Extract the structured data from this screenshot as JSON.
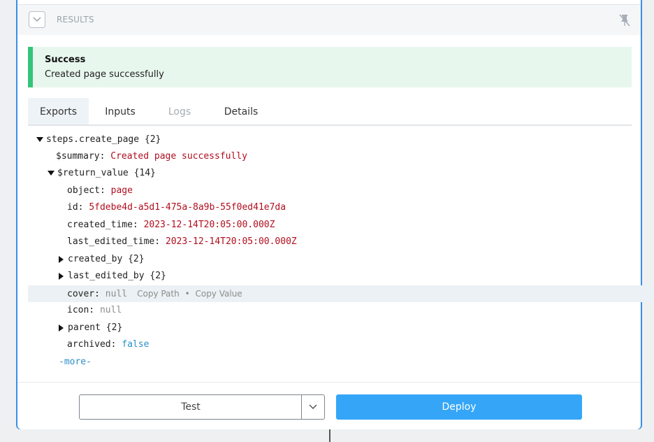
{
  "results": {
    "title": "RESULTS"
  },
  "alert": {
    "title": "Success",
    "message": "Created page successfully"
  },
  "tabs": [
    {
      "label": "Exports",
      "state": "active"
    },
    {
      "label": "Inputs",
      "state": "normal"
    },
    {
      "label": "Logs",
      "state": "disabled"
    },
    {
      "label": "Details",
      "state": "normal"
    }
  ],
  "tree": {
    "root_key": "steps.create_page",
    "root_count": "{2}",
    "summary_key": "$summary:",
    "summary_value": "Created page successfully",
    "return_key": "$return_value",
    "return_count": "{14}",
    "object_key": "object:",
    "object_value": "page",
    "id_key": "id:",
    "id_value": "5fdebe4d-a5d1-475a-8a9b-55f0ed41e7da",
    "created_time_key": "created_time:",
    "created_time_value": "2023-12-14T20:05:00.000Z",
    "last_edited_time_key": "last_edited_time:",
    "last_edited_time_value": "2023-12-14T20:05:00.000Z",
    "created_by_key": "created_by",
    "created_by_count": "{2}",
    "last_edited_by_key": "last_edited_by",
    "last_edited_by_count": "{2}",
    "cover_key": "cover:",
    "cover_value": "null",
    "copy_path": "Copy Path",
    "copy_sep": "•",
    "copy_value": "Copy Value",
    "icon_key": "icon:",
    "icon_value": "null",
    "parent_key": "parent",
    "parent_count": "{2}",
    "archived_key": "archived:",
    "archived_value": "false",
    "more": "-more-"
  },
  "footer": {
    "test_label": "Test",
    "deploy_label": "Deploy"
  },
  "colors": {
    "accent": "#35a6f7",
    "success": "#34c47a",
    "string": "#b00e1e",
    "boolean": "#2f8fc9"
  },
  "icons": {
    "collapse": "chevron-down-icon",
    "pin": "unpin-icon",
    "dropdown": "chevron-down-icon"
  }
}
